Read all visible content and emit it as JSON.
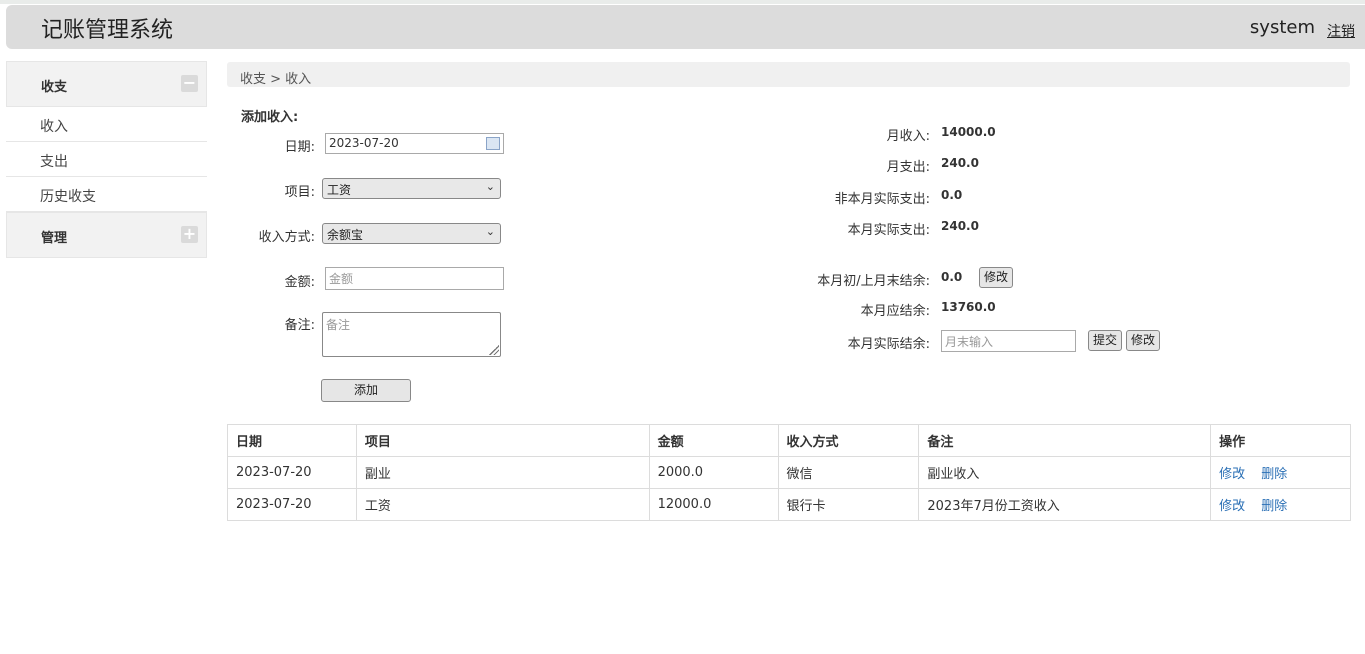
{
  "app": {
    "title": "记账管理系统",
    "user": "system",
    "logout_label": "注销"
  },
  "sidebar": {
    "group1": {
      "label": "收支",
      "toggle": "−"
    },
    "items": [
      {
        "label": "收入"
      },
      {
        "label": "支出"
      },
      {
        "label": "历史收支"
      }
    ],
    "group2": {
      "label": "管理",
      "toggle": "+"
    }
  },
  "breadcrumb": "收支 > 收入",
  "form": {
    "title": "添加收入:",
    "date_label": "日期:",
    "date_value": "2023-07-20",
    "item_label": "项目:",
    "item_value": "工资",
    "method_label": "收入方式:",
    "method_value": "余额宝",
    "amount_label": "金额:",
    "amount_placeholder": "金额",
    "note_label": "备注:",
    "note_placeholder": "备注",
    "add_button": "添加"
  },
  "summary": {
    "monthly_income_label": "月收入:",
    "monthly_income": "14000.0",
    "monthly_expense_label": "月支出:",
    "monthly_expense": "240.0",
    "non_month_expense_label": "非本月实际支出:",
    "non_month_expense": "0.0",
    "month_actual_expense_label": "本月实际支出:",
    "month_actual_expense": "240.0",
    "opening_balance_label": "本月初/上月末结余:",
    "opening_balance": "0.0",
    "modify_label": "修改",
    "expected_balance_label": "本月应结余:",
    "expected_balance": "13760.0",
    "actual_balance_label": "本月实际结余:",
    "actual_balance_placeholder": "月末输入",
    "submit_label": "提交"
  },
  "table": {
    "headers": [
      "日期",
      "项目",
      "金额",
      "收入方式",
      "备注",
      "操作"
    ],
    "rows": [
      {
        "date": "2023-07-20",
        "item": "副业",
        "amount": "2000.0",
        "method": "微信",
        "note": "副业收入"
      },
      {
        "date": "2023-07-20",
        "item": "工资",
        "amount": "12000.0",
        "method": "银行卡",
        "note": "2023年7月份工资收入"
      }
    ],
    "edit_label": "修改",
    "delete_label": "删除"
  }
}
